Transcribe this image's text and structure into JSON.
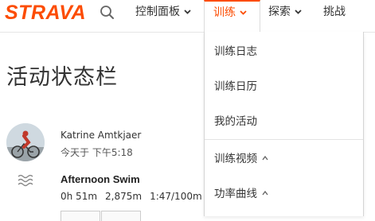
{
  "brand": {
    "logo_text": "STRAVA",
    "accent_color": "#fc4c02"
  },
  "nav": {
    "search_icon": "search-icon",
    "dashboard_label": "控制面板",
    "training_label": "训练",
    "explore_label": "探索",
    "challenges_label": "挑战"
  },
  "training_menu": {
    "items": [
      {
        "label": "训练日志"
      },
      {
        "label": "训练日历"
      },
      {
        "label": "我的活动"
      },
      {
        "label": "训练视频",
        "premium_icon": "premium-chevron-icon"
      },
      {
        "label": "功率曲线",
        "premium_icon": "premium-chevron-icon"
      }
    ]
  },
  "page": {
    "title": "活动状态栏"
  },
  "feed": {
    "athlete_name": "Katrine Amtkjaer",
    "timestamp": "今天于 下午5:18",
    "activity_icon": "swim-icon",
    "activity_title": "Afternoon Swim",
    "stats": {
      "time": "0h 51m",
      "distance": "2,875m",
      "pace": "1:47/100m"
    }
  }
}
